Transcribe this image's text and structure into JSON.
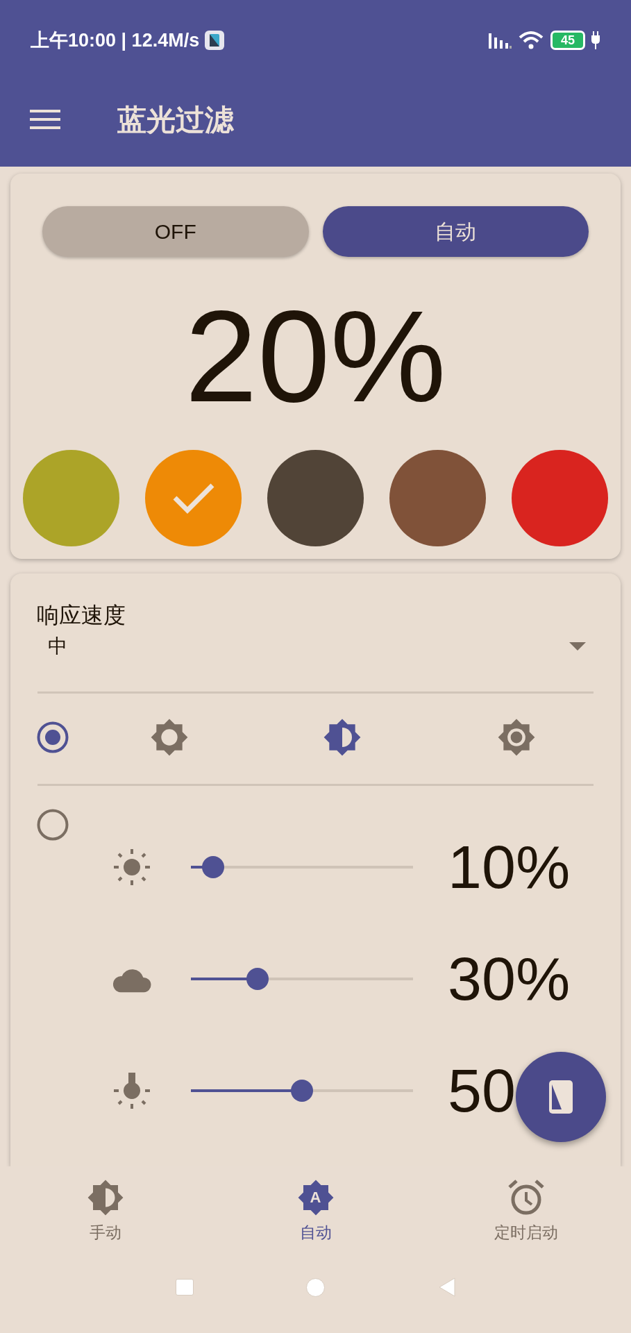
{
  "status_bar": {
    "time": "上午10:00 | 12.4M/s",
    "battery": "45"
  },
  "app_bar": {
    "title": "蓝光过滤"
  },
  "mode_toggle": [
    {
      "label": "OFF",
      "selected": false
    },
    {
      "label": "自动",
      "selected": true
    }
  ],
  "intensity": "20%",
  "colors": [
    {
      "color": "#aca428",
      "selected": false
    },
    {
      "color": "#ee8a06",
      "selected": true
    },
    {
      "color": "#514437",
      "selected": false
    },
    {
      "color": "#805239",
      "selected": false
    },
    {
      "color": "#d9241f",
      "selected": false
    }
  ],
  "response_speed": {
    "label": "响应速度",
    "value": "中"
  },
  "preset_option": {
    "selected": true
  },
  "brightness_modes": [
    {
      "kind": "low",
      "selected": false
    },
    {
      "kind": "medium",
      "selected": true
    },
    {
      "kind": "high",
      "selected": false
    }
  ],
  "custom_option": {
    "selected": false
  },
  "sliders": [
    {
      "kind": "sun",
      "level": 0.1,
      "reading": "10%"
    },
    {
      "kind": "cloud",
      "level": 0.3,
      "reading": "30%"
    },
    {
      "kind": "bulb",
      "level": 0.5,
      "reading": "50"
    }
  ],
  "bottom_nav": [
    {
      "kind": "manual",
      "label": "手动",
      "selected": false
    },
    {
      "kind": "auto",
      "label": "自动",
      "selected": true,
      "icon_letter": "A"
    },
    {
      "kind": "timer",
      "label": "定时启动",
      "selected": false
    }
  ]
}
